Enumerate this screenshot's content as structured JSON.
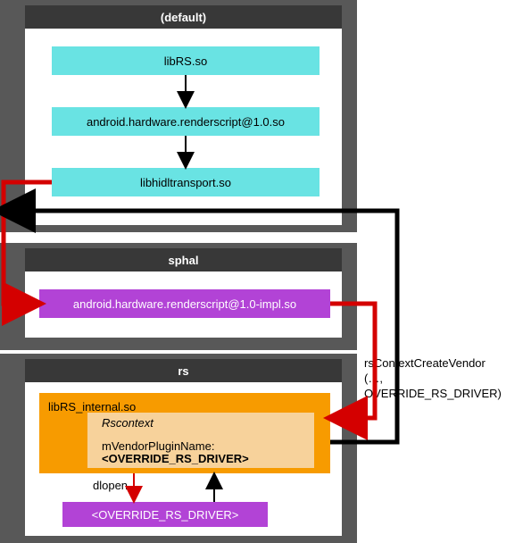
{
  "groups": {
    "default": {
      "title": "(default)"
    },
    "sphal": {
      "title": "sphal"
    },
    "rs": {
      "title": "rs"
    }
  },
  "nodes": {
    "libRS": "libRS.so",
    "hwrs": "android.hardware.renderscript@1.0.so",
    "hidl": "libhidltransport.so",
    "impl": "android.hardware.renderscript@1.0-impl.so",
    "libRSint": "libRS_internal.so",
    "rsctx_title": "Rscontext",
    "rsctx_field": "mVendorPluginName:",
    "rsctx_val": "<OVERRIDE_RS_DRIVER>",
    "orsd": "<OVERRIDE_RS_DRIVER>"
  },
  "labels": {
    "dlopen": "dlopen",
    "call1": "rsContextCreateVendor",
    "call2": "(…, OVERRIDE_RS_DRIVER)"
  }
}
